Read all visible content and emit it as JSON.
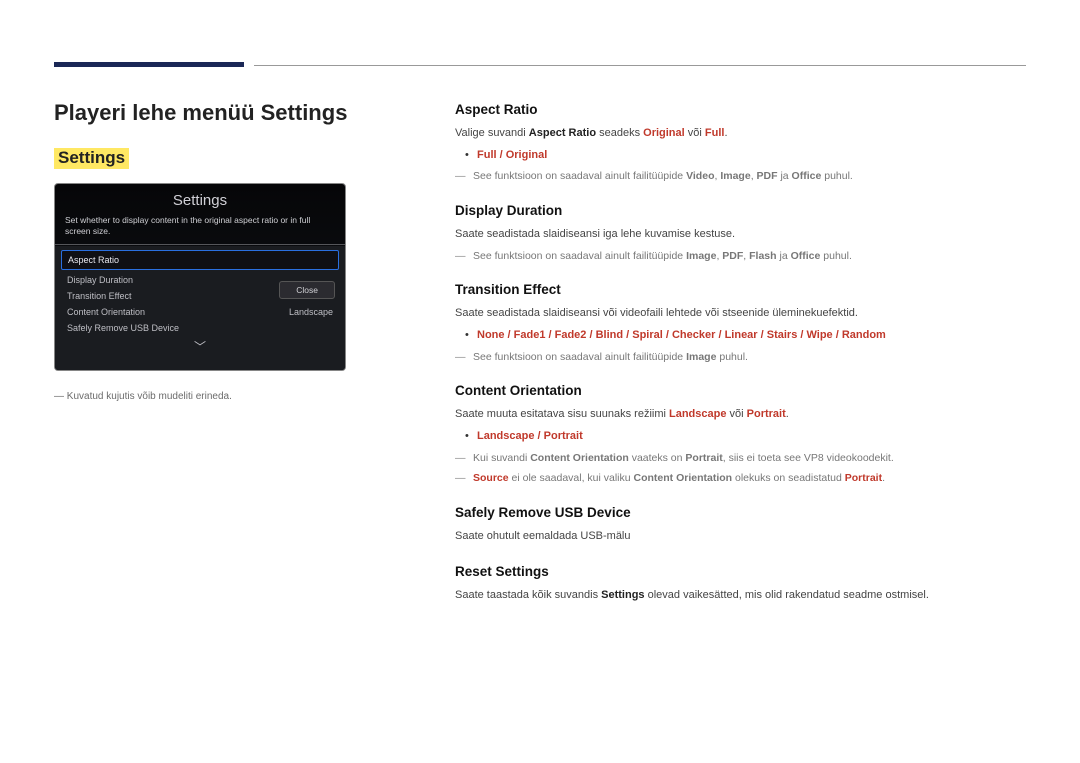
{
  "page_title": "Playeri lehe menüü Settings",
  "highlight": "Settings",
  "device_panel": {
    "title": "Settings",
    "subtext": "Set whether to display content in the original aspect ratio or in full screen size.",
    "items": [
      {
        "label": "Aspect Ratio",
        "value": "",
        "selected": true
      },
      {
        "label": "Display Duration",
        "value": ""
      },
      {
        "label": "Transition Effect",
        "value": ""
      },
      {
        "label": "Content Orientation",
        "value": "Landscape"
      },
      {
        "label": "Safely Remove USB Device",
        "value": ""
      }
    ],
    "close_label": "Close"
  },
  "left_footnote_prefix": "― ",
  "left_footnote": "Kuvatud kujutis võib mudeliti erineda.",
  "sections": {
    "aspect": {
      "title": "Aspect Ratio",
      "p1_pre": "Valige suvandi ",
      "p1_b1": "Aspect Ratio",
      "p1_mid": " seadeks ",
      "p1_r1": "Original",
      "p1_mid2": " või ",
      "p1_r2": "Full",
      "p1_end": ".",
      "bullet": "Full / Original",
      "note_pre": "See funktsioon on saadaval ainult failitüüpide ",
      "note_r1": "Video",
      "note_s1": ", ",
      "note_r2": "Image",
      "note_s2": ", ",
      "note_r3": "PDF",
      "note_s3": " ja ",
      "note_r4": "Office",
      "note_end": " puhul."
    },
    "duration": {
      "title": "Display Duration",
      "p1": "Saate seadistada slaidiseansi iga lehe kuvamise kestuse.",
      "note_pre": "See funktsioon on saadaval ainult failitüüpide ",
      "note_r1": "Image",
      "note_s1": ", ",
      "note_r2": "PDF",
      "note_s2": ", ",
      "note_r3": "Flash",
      "note_s3": " ja ",
      "note_r4": "Office",
      "note_end": " puhul."
    },
    "transition": {
      "title": "Transition Effect",
      "p1": "Saate seadistada slaidiseansi või videofaili lehtede või stseenide üleminekuefektid.",
      "bullet": "None / Fade1 / Fade2 / Blind / Spiral / Checker / Linear / Stairs / Wipe / Random",
      "note_pre": "See funktsioon on saadaval ainult failitüüpide ",
      "note_r1": "Image",
      "note_end": " puhul."
    },
    "orientation": {
      "title": "Content Orientation",
      "p1_pre": "Saate muuta esitatava sisu suunaks režiimi ",
      "p1_r1": "Landscape",
      "p1_mid": " või ",
      "p1_r2": "Portrait",
      "p1_end": ".",
      "bullet": "Landscape / Portrait",
      "note1_pre": "Kui suvandi ",
      "note1_b1": "Content Orientation",
      "note1_mid": " vaateks on ",
      "note1_b2": "Portrait",
      "note1_end": ", siis ei toeta see VP8 videokoodekit.",
      "note2_r1": "Source",
      "note2_mid": " ei ole saadaval, kui valiku ",
      "note2_b1": "Content Orientation",
      "note2_mid2": " olekuks on seadistatud ",
      "note2_r2": "Portrait",
      "note2_end": "."
    },
    "usb": {
      "title": "Safely Remove USB Device",
      "p1": "Saate ohutult eemaldada USB-mälu"
    },
    "reset": {
      "title": "Reset Settings",
      "p1_pre": "Saate taastada kõik suvandis ",
      "p1_b1": "Settings",
      "p1_end": " olevad vaikesätted, mis olid rakendatud seadme ostmisel."
    }
  }
}
